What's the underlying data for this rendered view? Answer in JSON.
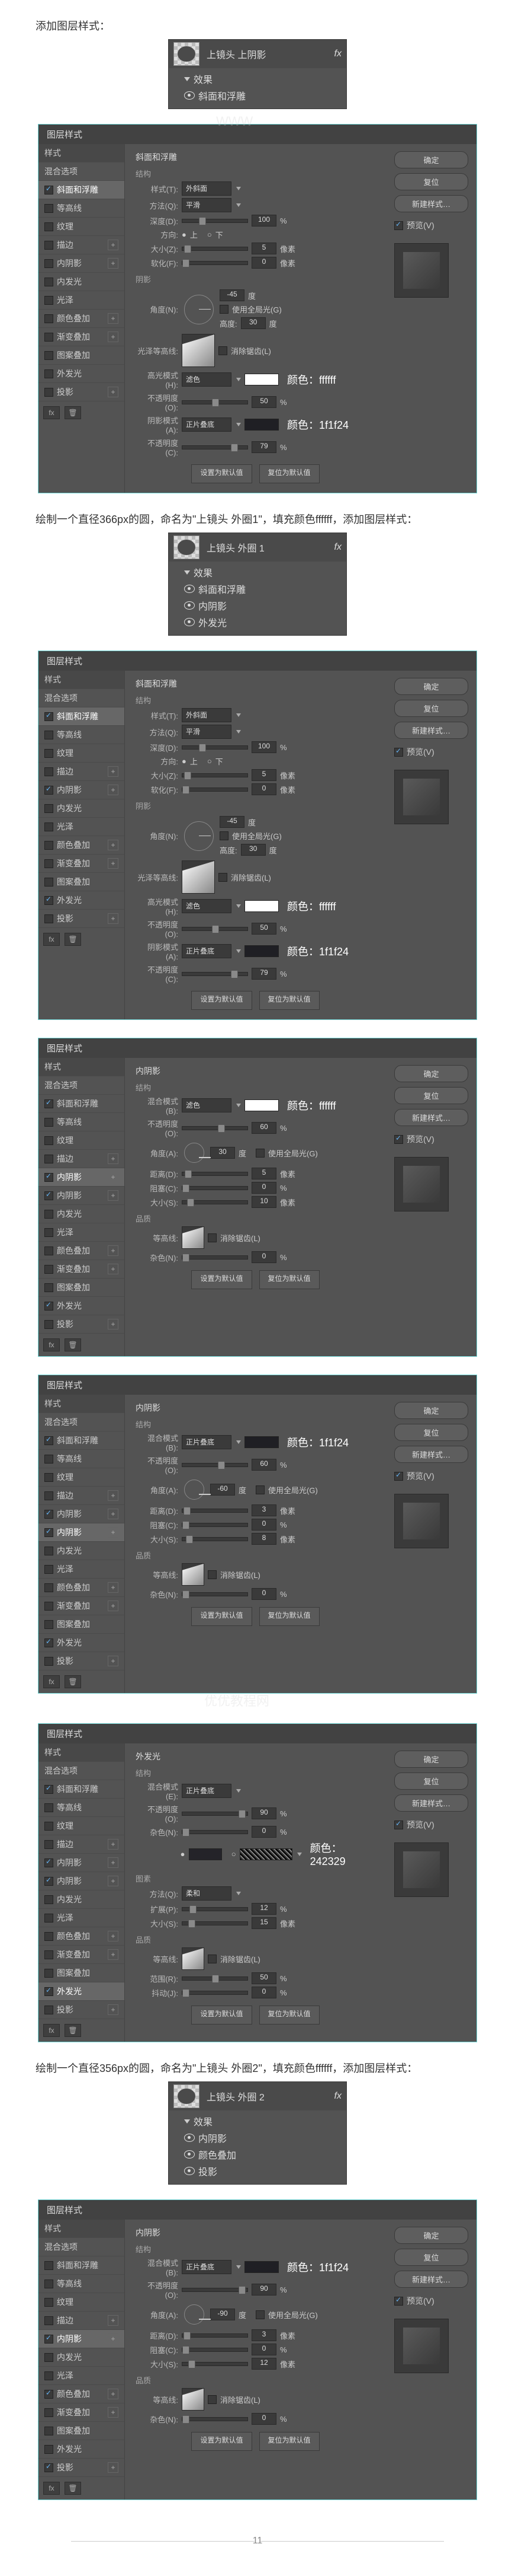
{
  "intro1": "添加图层样式：",
  "intro2": "绘制一个直径366px的圆，命名为\"上镜头 外圈1\"，填充颜色ffffff，添加图层样式：",
  "intro3": "绘制一个直径356px的圆，命名为\"上镜头 外圈2\"，填充颜色ffffff，添加图层样式：",
  "page_number": "11",
  "fx_abbrev": "fx",
  "dlg_title": "图层样式",
  "watermark_lines": [
    "WWW",
    "优优教程网"
  ],
  "layer_panel1": {
    "title": "上镜头 上阴影",
    "items": [
      "效果",
      "斜面和浮雕"
    ]
  },
  "layer_panel2": {
    "title": "上镜头 外圈 1",
    "items": [
      "效果",
      "斜面和浮雕",
      "内阴影",
      "外发光"
    ]
  },
  "layer_panel3": {
    "title": "上镜头 外圈 2",
    "items": [
      "效果",
      "内阴影",
      "颜色叠加",
      "投影"
    ]
  },
  "sidebar_labels": {
    "styles": "样式",
    "blend": "混合选项",
    "bevel": "斜面和浮雕",
    "contour": "等高线",
    "texture": "纹理",
    "stroke": "描边",
    "innerShadow": "内阴影",
    "innerGlow": "内发光",
    "satin": "光泽",
    "colorOverlay": "颜色叠加",
    "gradOverlay": "渐变叠加",
    "patOverlay": "图案叠加",
    "outerGlow": "外发光",
    "dropShadow": "投影"
  },
  "right": {
    "ok": "确定",
    "cancel": "复位",
    "newStyle": "新建样式…",
    "preview": "预览(V)"
  },
  "bevel_section": {
    "title": "斜面和浮雕",
    "sub1": "结构",
    "style": "样式(T):",
    "style_v": "外斜面",
    "tech": "方法(Q):",
    "tech_v": "平滑",
    "depth": "深度(D):",
    "depth_v": "100",
    "pct": "%",
    "dir": "方向:",
    "up": "上",
    "down": "下",
    "size": "大小(Z):",
    "size_v": "5",
    "px": "像素",
    "soft": "软化(F):",
    "soft_v": "0",
    "shade": "阴影",
    "angle": "角度(N):",
    "angle_v": "-45",
    "deg": "度",
    "global": "使用全局光(G)",
    "alt": "高度:",
    "alt_v": "30",
    "gloss": "光泽等高线:",
    "aa": "消除锯齿(L)",
    "hmode": "高光模式(H):",
    "screen": "滤色",
    "hopac": "不透明度(O):",
    "hopac_v": "50",
    "smode": "阴影模式(A):",
    "mult": "正片叠底",
    "sopac": "不透明度(C):",
    "sopac_v": "79",
    "default": "设置为默认值",
    "reset": "复位为默认值",
    "c1": "颜色：ffffff",
    "c2": "颜色：1f1f24"
  },
  "innerShadow_section": {
    "title": "内阴影",
    "sub1": "结构",
    "mode": "混合模式(B):",
    "mode_v": "滤色",
    "opac": "不透明度(O):",
    "opac_v": "60",
    "angle": "角度(A):",
    "angle_v": "30",
    "global": "使用全局光(G)",
    "dist": "距离(D):",
    "dist_v": "5",
    "px": "像素",
    "choke": "阻塞(C):",
    "choke_v": "0",
    "pct": "%",
    "size": "大小(S):",
    "size_v": "10",
    "quality": "品质",
    "contour": "等高线:",
    "aa": "消除锯齿(L)",
    "noise": "杂色(N):",
    "noise_v": "0",
    "default": "设置为默认值",
    "reset": "复位为默认值",
    "c1": "颜色：ffffff"
  },
  "innerShadow2_section": {
    "title": "内阴影",
    "mode_v": "正片叠底",
    "opac_v": "60",
    "angle_v": "-60",
    "dist_v": "3",
    "size_v": "8",
    "c1": "颜色：1f1f24"
  },
  "outerGlow_section": {
    "title": "外发光",
    "sub1": "结构",
    "mode": "混合模式(E):",
    "mode_v": "正片叠底",
    "opac": "不透明度(O):",
    "opac_v": "90",
    "noise": "杂色(N):",
    "noise_v": "0",
    "elem": "图素",
    "tech": "方法(Q):",
    "tech_v": "柔和",
    "spread": "扩展(P):",
    "spread_v": "12",
    "size": "大小(S):",
    "size_v": "15",
    "quality": "品质",
    "contour": "等高线:",
    "aa": "消除锯齿(L)",
    "range": "范围(R):",
    "range_v": "50",
    "jitter": "抖动(J):",
    "jitter_v": "0",
    "default": "设置为默认值",
    "reset": "复位为默认值",
    "c1": "颜色：242329"
  },
  "innerShadow3_section": {
    "title": "内阴影",
    "mode_v": "正片叠底",
    "opac_v": "90",
    "angle_v": "-90",
    "dist_v": "3",
    "size_v": "12",
    "c1": "颜色：1f1f24"
  }
}
